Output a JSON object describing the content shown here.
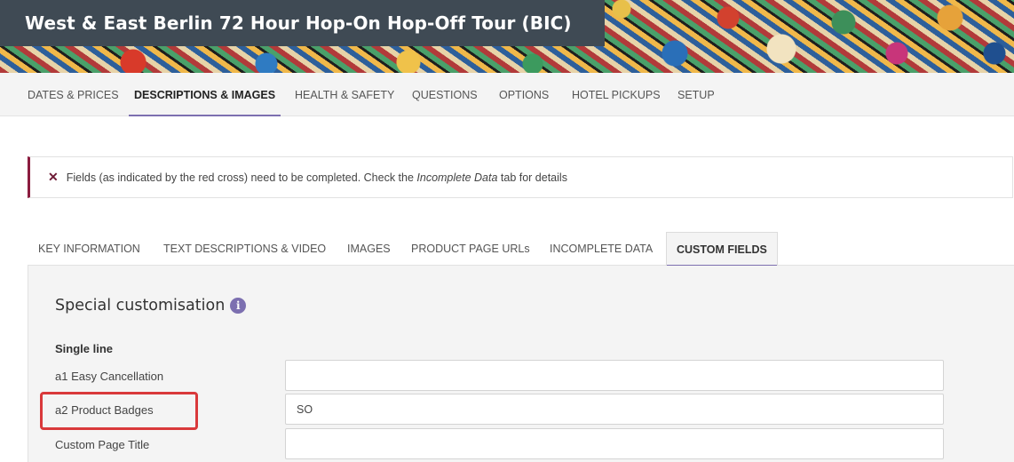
{
  "header": {
    "title": "West & East Berlin 72 Hour Hop-On Hop-Off Tour (BIC)"
  },
  "main_nav": {
    "tabs": [
      {
        "label": "DATES & PRICES"
      },
      {
        "label": "DESCRIPTIONS & IMAGES",
        "active": true
      },
      {
        "label": "HEALTH & SAFETY"
      },
      {
        "label": "QUESTIONS"
      },
      {
        "label": "OPTIONS"
      },
      {
        "label": "HOTEL PICKUPS"
      },
      {
        "label": "SETUP"
      }
    ]
  },
  "alert": {
    "icon": "close-x-icon",
    "text_before": "Fields (as indicated by the red cross) need to be completed. Check the ",
    "text_em": "Incomplete Data",
    "text_after": " tab for details",
    "color": "#8b1c3f"
  },
  "sub_tabs": {
    "tabs": [
      {
        "label": "KEY INFORMATION"
      },
      {
        "label": "TEXT DESCRIPTIONS & VIDEO"
      },
      {
        "label": "IMAGES"
      },
      {
        "label": "PRODUCT PAGE URLs"
      },
      {
        "label": "INCOMPLETE DATA"
      },
      {
        "label": "CUSTOM FIELDS",
        "active": true
      }
    ]
  },
  "panel": {
    "section_title": "Special customisation",
    "info_icon": "info-icon",
    "info_glyph": "i",
    "group_title": "Single line",
    "fields": [
      {
        "label": "a1 Easy Cancellation",
        "value": ""
      },
      {
        "label": "a2 Product Badges",
        "value": "SO",
        "highlighted": true
      },
      {
        "label": "Custom Page Title",
        "value": ""
      }
    ]
  },
  "colors": {
    "accent": "#7c6fb0",
    "header_bg": "#3f4a54",
    "highlight": "#d9393b"
  }
}
